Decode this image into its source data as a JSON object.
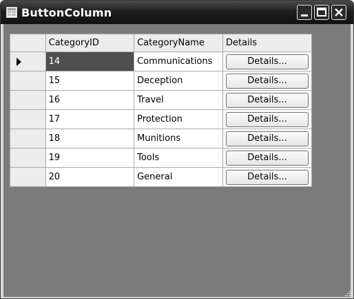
{
  "window": {
    "title": "ButtonColumn"
  },
  "grid": {
    "headers": [
      "CategoryID",
      "CategoryName",
      "Details"
    ],
    "rows": [
      {
        "id": "14",
        "name": "Communications",
        "button": "Details..."
      },
      {
        "id": "15",
        "name": "Deception",
        "button": "Details..."
      },
      {
        "id": "16",
        "name": "Travel",
        "button": "Details..."
      },
      {
        "id": "17",
        "name": "Protection",
        "button": "Details..."
      },
      {
        "id": "18",
        "name": "Munitions",
        "button": "Details..."
      },
      {
        "id": "19",
        "name": "Tools",
        "button": "Details..."
      },
      {
        "id": "20",
        "name": "General",
        "button": "Details..."
      }
    ],
    "current_row_index": 0
  },
  "icons": {
    "app": "grid-app-icon",
    "minimize": "minimize-icon",
    "maximize": "maximize-icon",
    "close": "close-icon",
    "current_row": "current-row-arrow-icon",
    "resize": "resize-grip-icon"
  }
}
